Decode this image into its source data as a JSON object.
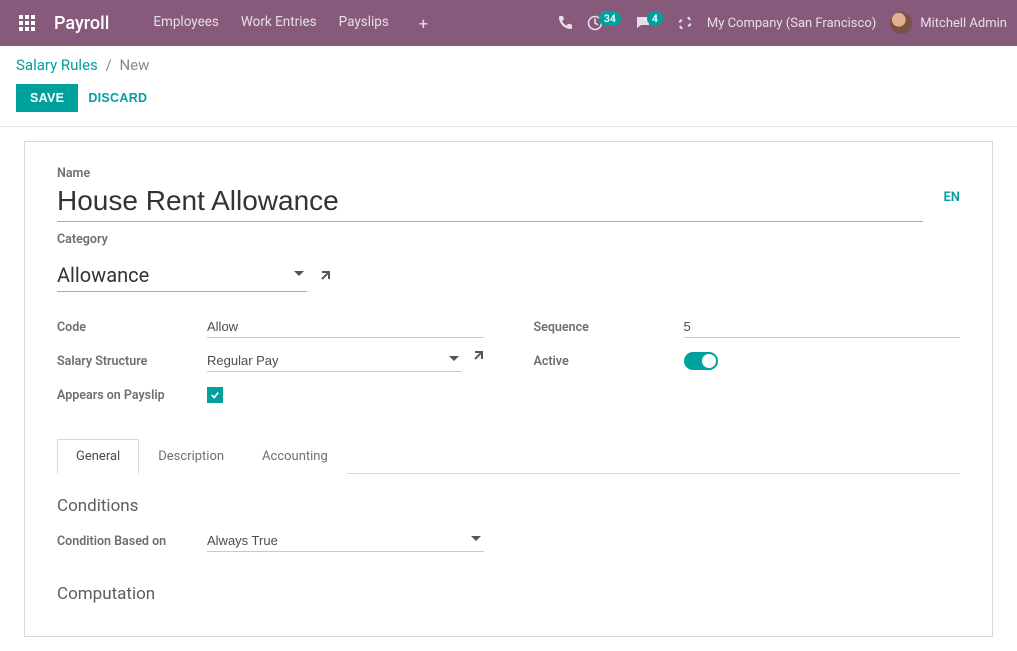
{
  "navbar": {
    "brand": "Payroll",
    "menu": [
      "Employees",
      "Work Entries",
      "Payslips"
    ],
    "badges": {
      "clock": "34",
      "chat": "4"
    },
    "company": "My Company (San Francisco)",
    "user": "Mitchell Admin"
  },
  "breadcrumb": {
    "root": "Salary Rules",
    "current": "New"
  },
  "actions": {
    "save": "SAVE",
    "discard": "DISCARD"
  },
  "form": {
    "name_label": "Name",
    "name_value": "House Rent Allowance",
    "lang_btn": "EN",
    "category_label": "Category",
    "category_value": "Allowance",
    "left": {
      "code_label": "Code",
      "code_value": "Allow",
      "structure_label": "Salary Structure",
      "structure_value": "Regular Pay",
      "appears_label": "Appears on Payslip"
    },
    "right": {
      "sequence_label": "Sequence",
      "sequence_value": "5",
      "active_label": "Active"
    }
  },
  "tabs": [
    "General",
    "Description",
    "Accounting"
  ],
  "general": {
    "conditions_title": "Conditions",
    "condition_based_label": "Condition Based on",
    "condition_based_value": "Always True",
    "computation_title": "Computation"
  }
}
